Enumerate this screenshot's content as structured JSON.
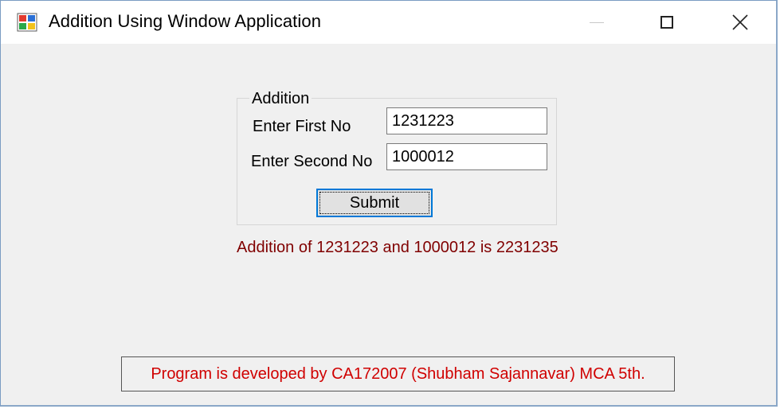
{
  "window": {
    "title": "Addition Using Window Application",
    "controls": {
      "minimize": "minimize-icon",
      "maximize": "maximize-icon",
      "close": "close-icon"
    }
  },
  "group": {
    "legend": "Addition"
  },
  "form": {
    "first_label": "Enter First No",
    "first_value": "1231223",
    "second_label": "Enter Second No",
    "second_value": "1000012",
    "submit_label": "Submit"
  },
  "result": {
    "text": "Addition of 1231223 and 1000012 is 2231235"
  },
  "footer": {
    "text": "Program is developed by CA172007 (Shubham Sajannavar) MCA 5th."
  },
  "colors": {
    "result_text": "#800000",
    "footer_text": "#d00000",
    "focus_border": "#0078d7"
  }
}
